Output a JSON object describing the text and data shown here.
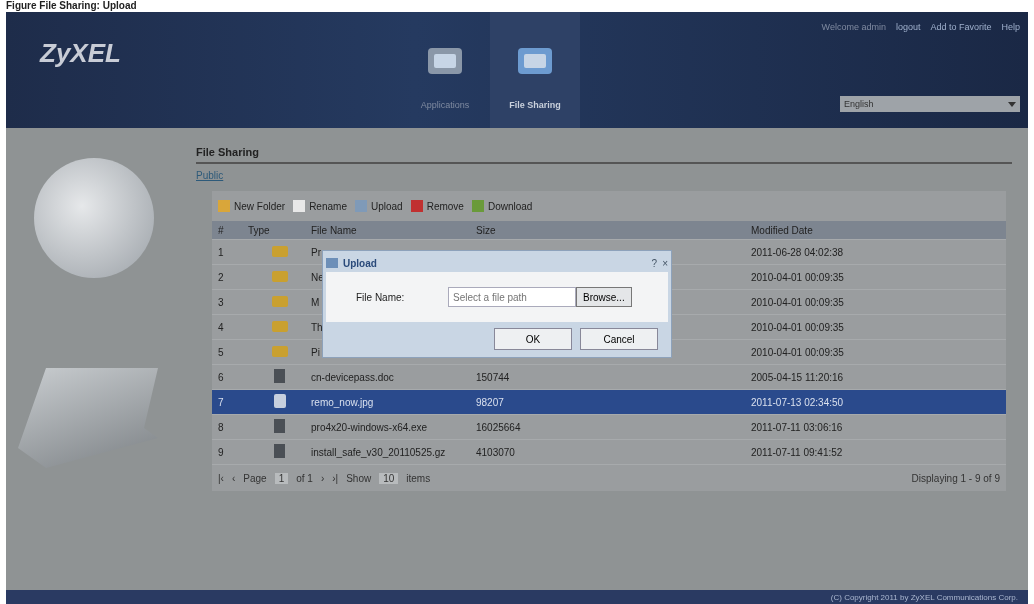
{
  "caption": "Figure File Sharing: Upload",
  "header": {
    "logo": "ZyXEL",
    "welcome": "Welcome admin",
    "logout": "logout",
    "favorite": "Add to Favorite",
    "help": "Help",
    "language": "English",
    "nav": [
      {
        "label": "Applications",
        "selected": false
      },
      {
        "label": "File Sharing",
        "selected": true
      }
    ]
  },
  "panel": {
    "title": "File Sharing",
    "breadcrumb": "Public",
    "toolbar": [
      "New Folder",
      "Rename",
      "Upload",
      "Remove",
      "Download"
    ],
    "columns": [
      "#",
      "Type",
      "File Name",
      "Size",
      "Modified Date"
    ],
    "rows": [
      {
        "index": "1",
        "kind": "folder",
        "name": "Pr",
        "size": "",
        "date": "2011-06-28 04:02:38",
        "selected": false
      },
      {
        "index": "2",
        "kind": "folder",
        "name": "Ne",
        "size": "",
        "date": "2010-04-01 00:09:35",
        "selected": false
      },
      {
        "index": "3",
        "kind": "folder",
        "name": "M",
        "size": "",
        "date": "2010-04-01 00:09:35",
        "selected": false
      },
      {
        "index": "4",
        "kind": "folder",
        "name": "Th",
        "size": "",
        "date": "2010-04-01 00:09:35",
        "selected": false
      },
      {
        "index": "5",
        "kind": "folder",
        "name": "Pi",
        "size": "",
        "date": "2010-04-01 00:09:35",
        "selected": false
      },
      {
        "index": "6",
        "kind": "file",
        "name": "cn-devicepass.doc",
        "size": "150744",
        "date": "2005-04-15 11:20:16",
        "selected": false
      },
      {
        "index": "7",
        "kind": "image",
        "name": "remo_now.jpg",
        "size": "98207",
        "date": "2011-07-13 02:34:50",
        "selected": true
      },
      {
        "index": "8",
        "kind": "file",
        "name": "pro4x20-windows-x64.exe",
        "size": "16025664",
        "date": "2011-07-11 03:06:16",
        "selected": false
      },
      {
        "index": "9",
        "kind": "file",
        "name": "install_safe_v30_20110525.gz",
        "size": "4103070",
        "date": "2011-07-11 09:41:52",
        "selected": false
      }
    ],
    "pager": {
      "first": "|‹",
      "prev": "‹",
      "next": "›",
      "last": "›|",
      "page_label": "Page",
      "page": "1",
      "of": "of 1",
      "show": "Show",
      "per_page": "10",
      "items": "items",
      "displaying": "Displaying 1 - 9 of 9"
    }
  },
  "dialog": {
    "title": "Upload",
    "help": "?",
    "close": "×",
    "label": "File Name:",
    "placeholder": "Select a file path",
    "browse": "Browse...",
    "ok": "OK",
    "cancel": "Cancel"
  },
  "footer": "(C) Copyright 2011 by ZyXEL Communications Corp."
}
